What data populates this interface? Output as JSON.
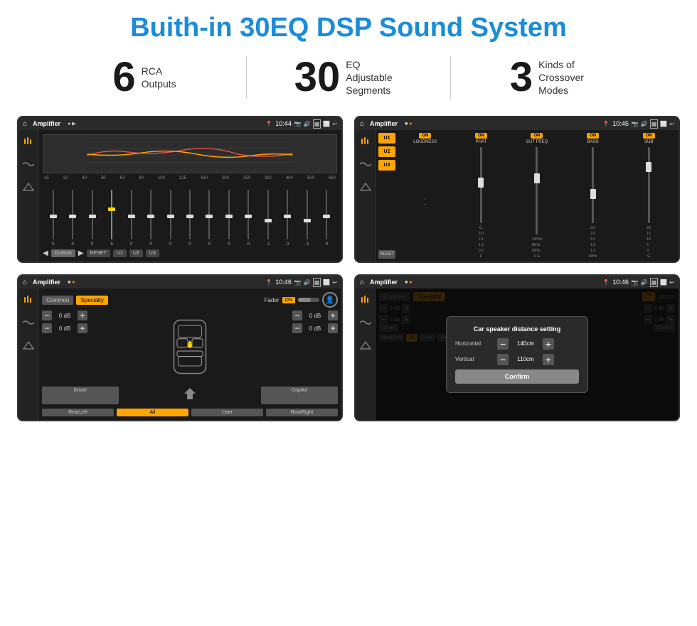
{
  "page": {
    "title": "Buith-in 30EQ DSP Sound System",
    "stats": [
      {
        "number": "6",
        "label": "RCA\nOutputs"
      },
      {
        "number": "30",
        "label": "EQ Adjustable\nSegments"
      },
      {
        "number": "3",
        "label": "Kinds of\nCrossover Modes"
      }
    ],
    "screens": [
      {
        "id": "eq-screen",
        "statusBar": {
          "title": "Amplifier",
          "time": "10:44",
          "dots": [
            "normal",
            "normal"
          ]
        },
        "type": "equalizer"
      },
      {
        "id": "amp-screen",
        "statusBar": {
          "title": "Amplifier",
          "time": "10:45",
          "dots": [
            "normal",
            "orange"
          ]
        },
        "type": "amplifier"
      },
      {
        "id": "cross-screen",
        "statusBar": {
          "title": "Amplifier",
          "time": "10:46",
          "dots": [
            "normal",
            "orange"
          ]
        },
        "type": "crossover"
      },
      {
        "id": "dialog-screen",
        "statusBar": {
          "title": "Amplifier",
          "time": "10:46",
          "dots": [
            "normal",
            "orange"
          ]
        },
        "type": "dialog"
      }
    ],
    "eqFrequencies": [
      "25",
      "32",
      "40",
      "50",
      "63",
      "80",
      "100",
      "125",
      "160",
      "200",
      "250",
      "320",
      "400",
      "500",
      "630"
    ],
    "eqValues": [
      "0",
      "0",
      "0",
      "5",
      "0",
      "0",
      "0",
      "0",
      "0",
      "0",
      "0",
      "-1",
      "0",
      "-1",
      "0"
    ],
    "eqPresets": [
      "Custom",
      "RESET",
      "U1",
      "U2",
      "U3"
    ],
    "ampPresets": [
      "U1",
      "U2",
      "U3"
    ],
    "ampControls": [
      {
        "label": "LOUDNESS",
        "on": true
      },
      {
        "label": "PHAT",
        "on": true
      },
      {
        "label": "CUT FREQ",
        "on": true
      },
      {
        "label": "BASS",
        "on": true
      },
      {
        "label": "SUB",
        "on": true
      }
    ],
    "crossover": {
      "tabs": [
        "Common",
        "Specialty"
      ],
      "activeTab": "Specialty",
      "faderLabel": "Fader",
      "faderOn": true,
      "dbValues": [
        "0 dB",
        "0 dB",
        "0 dB",
        "0 dB"
      ],
      "bottomBtns": [
        "Driver",
        "Copilot",
        "RearLeft",
        "All",
        "User",
        "RearRight"
      ]
    },
    "dialog": {
      "title": "Car speaker distance setting",
      "horizontal": {
        "label": "Horizontal",
        "value": "140cm"
      },
      "vertical": {
        "label": "Vertical",
        "value": "110cm"
      },
      "confirmBtn": "Confirm",
      "driverBtn": "Driver",
      "copilotBtn": "Copilot",
      "rearLeftBtn": "RearLeft",
      "allBtn": "All",
      "userBtn": "User",
      "rearRightBtn": "RearRight"
    }
  }
}
